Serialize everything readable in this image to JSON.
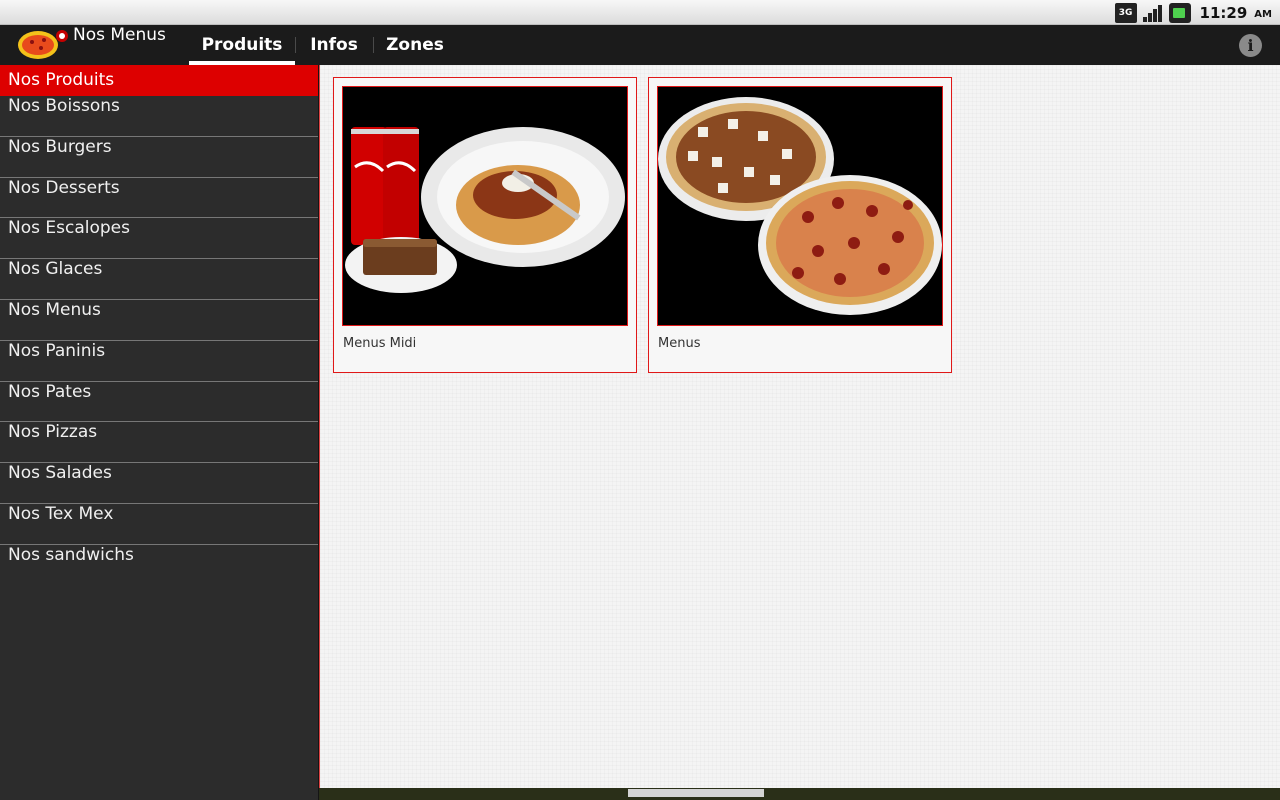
{
  "status": {
    "network_badge": "3G",
    "time": "11:29",
    "ampm": "AM"
  },
  "actionbar": {
    "title": "Nos Menus",
    "tabs": [
      {
        "label": "Produits",
        "active": true
      },
      {
        "label": "Infos",
        "active": false
      },
      {
        "label": "Zones",
        "active": false
      }
    ],
    "info_icon": "i"
  },
  "sidebar": {
    "items": [
      {
        "label": "Nos Produits",
        "active": true
      },
      {
        "label": "Nos Boissons"
      },
      {
        "label": "Nos Burgers"
      },
      {
        "label": "Nos Desserts"
      },
      {
        "label": "Nos Escalopes"
      },
      {
        "label": "Nos Glaces"
      },
      {
        "label": "Nos Menus"
      },
      {
        "label": "Nos Paninis"
      },
      {
        "label": "Nos Pates"
      },
      {
        "label": "Nos Pizzas"
      },
      {
        "label": "Nos Salades"
      },
      {
        "label": "Nos Tex Mex"
      },
      {
        "label": "Nos sandwichs"
      }
    ]
  },
  "main": {
    "cards": [
      {
        "label": "Menus Midi",
        "image": "pasta-cola-brownie-photo"
      },
      {
        "label": "Menus",
        "image": "two-pizzas-photo"
      }
    ]
  },
  "colors": {
    "accent_red": "#dd0000",
    "actionbar_bg": "#1b1b1b",
    "sidebar_bg": "#2c2c2c"
  }
}
